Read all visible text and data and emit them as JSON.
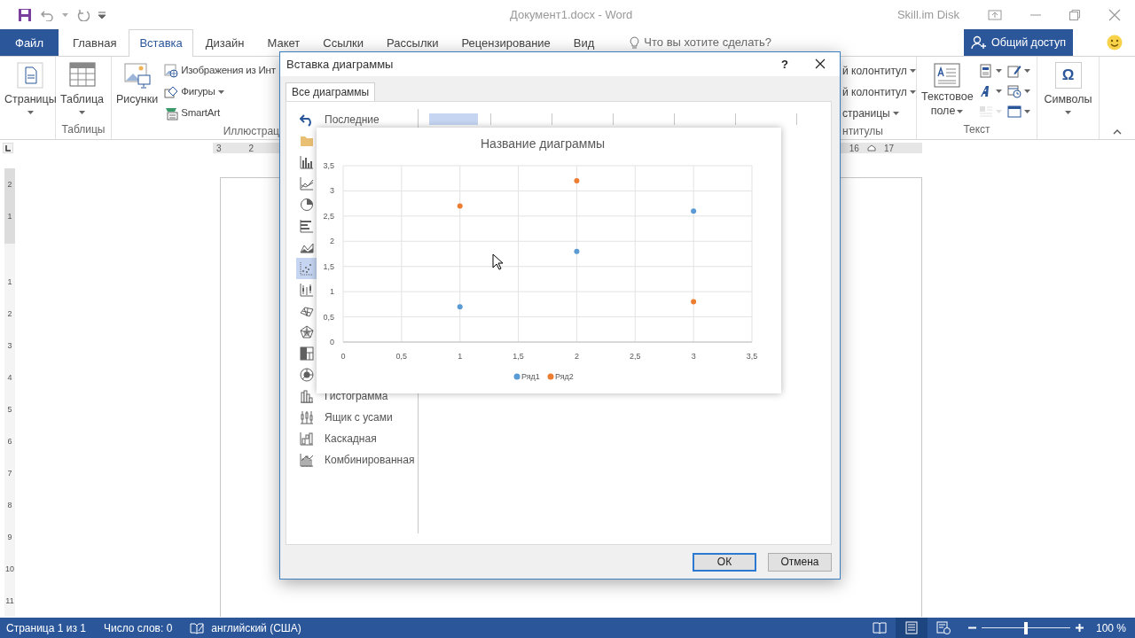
{
  "window": {
    "title": "Документ1.docx - Word",
    "account": "Skill.im Disk"
  },
  "ribbon_tabs": [
    {
      "label": "Файл",
      "kind": "file",
      "selected": false
    },
    {
      "label": "Главная",
      "kind": "tab",
      "selected": false
    },
    {
      "label": "Вставка",
      "kind": "tab",
      "selected": true
    },
    {
      "label": "Дизайн",
      "kind": "tab",
      "selected": false
    },
    {
      "label": "Макет",
      "kind": "tab",
      "selected": false
    },
    {
      "label": "Ссылки",
      "kind": "tab",
      "selected": false
    },
    {
      "label": "Рассылки",
      "kind": "tab",
      "selected": false
    },
    {
      "label": "Рецензирование",
      "kind": "tab",
      "selected": false
    },
    {
      "label": "Вид",
      "kind": "tab",
      "selected": false
    }
  ],
  "tell_me": {
    "text": "Что вы хотите сделать?"
  },
  "share_button": {
    "label": "Общий доступ"
  },
  "ribbon": {
    "pages_button": "Страницы",
    "tables_group": {
      "label": "Таблицы",
      "table_button": "Таблица"
    },
    "illustrations_group": {
      "label": "Иллюстрац",
      "pictures_button": "Рисунки",
      "small_buttons": [
        {
          "label": "Изображения из Инт",
          "dropdown": false
        },
        {
          "label": "Фигуры",
          "dropdown": true
        },
        {
          "label": "SmartArt",
          "dropdown": false
        }
      ]
    },
    "header_footer_group": {
      "label": "нтитулы",
      "items": [
        "й колонтитул",
        "й колонтитул",
        "страницы"
      ]
    },
    "text_group": {
      "label": "Текст",
      "text_box_button": "Текстовое поле",
      "small_tools": [
        {
          "disabled": false
        },
        {
          "disabled": false
        },
        {
          "disabled": false
        },
        {
          "disabled": false
        },
        {
          "disabled": true
        },
        {
          "disabled": false
        }
      ]
    },
    "symbols_group": {
      "glyph": "Ω",
      "button": "Символы"
    }
  },
  "ruler": {
    "marks": [
      "3",
      "2",
      "16",
      "17"
    ]
  },
  "vertical_ruler": [
    "2",
    "1",
    "1",
    "2",
    "3",
    "4",
    "5",
    "6",
    "7",
    "8",
    "9",
    "10",
    "11"
  ],
  "dialog": {
    "title": "Вставка диаграммы",
    "help": "?",
    "tabs": [
      {
        "label": "Все диаграммы",
        "selected": true
      }
    ],
    "chart_types": [
      {
        "label": "Последние",
        "selected": false
      },
      {
        "selected": false
      },
      {
        "selected": false
      },
      {
        "selected": false
      },
      {
        "selected": false
      },
      {
        "selected": false
      },
      {
        "selected": false
      },
      {
        "selected": true
      },
      {
        "selected": false
      },
      {
        "selected": false
      },
      {
        "selected": false
      },
      {
        "selected": false
      },
      {
        "selected": false
      },
      {
        "label": "Гистограмма",
        "selected": false
      },
      {
        "label": "Ящик с усами",
        "selected": false
      },
      {
        "label": "Каскадная",
        "selected": false
      },
      {
        "label": "Комбинированная",
        "selected": false
      }
    ],
    "subtypes": [
      {
        "selected": true
      },
      {
        "selected": false
      },
      {
        "selected": false
      },
      {
        "selected": false
      },
      {
        "selected": false
      },
      {
        "selected": false
      },
      {
        "selected": false
      }
    ],
    "preview": {
      "chart_data": {
        "type": "scatter",
        "title": "Название диаграммы",
        "x": [
          1,
          2,
          3
        ],
        "series": [
          {
            "name": "Ряд1",
            "color": "#5b9bd5",
            "values": [
              0.7,
              1.8,
              2.6
            ]
          },
          {
            "name": "Ряд2",
            "color": "#ed7d31",
            "values": [
              2.7,
              3.2,
              0.8
            ]
          }
        ],
        "xlim": [
          0,
          3.5
        ],
        "ylim": [
          0,
          3.5
        ],
        "grid": true,
        "legend": "bottom",
        "xticks": [
          0,
          {
            "value": 0.5,
            "label": "0,5"
          },
          1,
          {
            "value": 1.5,
            "label": "1,5"
          },
          2,
          {
            "value": 2.5,
            "label": "2,5"
          },
          3,
          {
            "value": 3.5,
            "label": "3,5"
          }
        ],
        "yticks": [
          0,
          {
            "value": 0.5,
            "label": "0,5"
          },
          1,
          {
            "value": 1.5,
            "label": "1,5"
          },
          2,
          {
            "value": 2.5,
            "label": "2,5"
          },
          3,
          {
            "value": 3.5,
            "label": "3,5"
          }
        ]
      }
    },
    "buttons": [
      {
        "label": "ОК",
        "default": true
      },
      {
        "label": "Отмена",
        "default": false
      }
    ]
  },
  "status_bar": {
    "page": "Страница 1 из 1",
    "words": "Число слов: 0",
    "language": "английский (США)",
    "views": [
      {
        "selected": false
      },
      {
        "selected": true
      },
      {
        "selected": false
      }
    ],
    "zoom": {
      "level": 0.5,
      "reading": "100 %"
    }
  }
}
